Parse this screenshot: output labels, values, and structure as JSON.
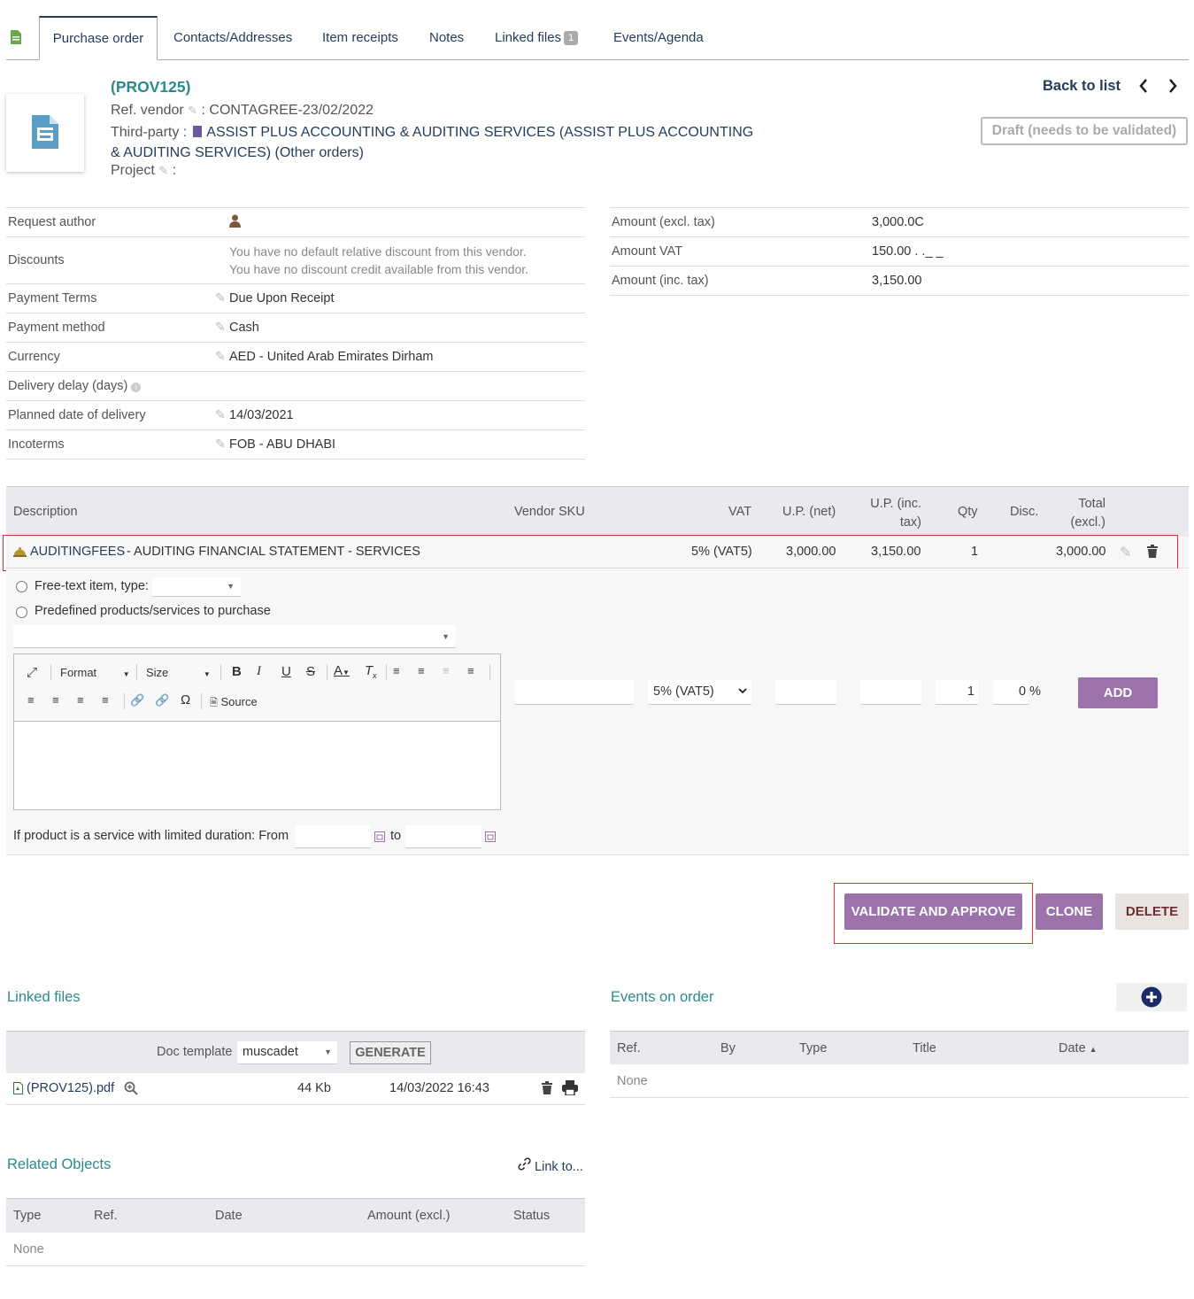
{
  "tabs": [
    {
      "label": "Purchase order"
    },
    {
      "label": "Contacts/Addresses"
    },
    {
      "label": "Item receipts"
    },
    {
      "label": "Notes"
    },
    {
      "label": "Linked files",
      "badge": "1"
    },
    {
      "label": "Events/Agenda"
    }
  ],
  "header": {
    "ref": "(PROV125)",
    "ref_vendor_label": "Ref. vendor",
    "ref_vendor_value": ": CONTAGREE-23/02/2022",
    "thirdparty_label": "Third-party :",
    "thirdparty_name_line1": "ASSIST PLUS ACCOUNTING & AUDITING SERVICES (ASSIST PLUS ACCOUNTING",
    "thirdparty_name_line2": "& AUDITING SERVICES)",
    "other_orders": "(Other orders)",
    "project_label": "Project",
    "project_suffix": ":",
    "back_to_list": "Back to list",
    "status": "Draft (needs to be validated)"
  },
  "fields": [
    {
      "label": "Request author",
      "value": ""
    },
    {
      "label": "Discounts",
      "value_line1": "You have no default relative discount from this vendor.",
      "value_line2": "You have no discount credit available from this vendor."
    },
    {
      "label": "Payment Terms",
      "value": "Due Upon Receipt"
    },
    {
      "label": "Payment method",
      "value": "Cash"
    },
    {
      "label": "Currency",
      "value": "AED - United Arab Emirates Dirham"
    },
    {
      "label": "Delivery delay (days)",
      "value": ""
    },
    {
      "label": "Planned date of delivery",
      "value": "14/03/2021"
    },
    {
      "label": "Incoterms",
      "value": "FOB - ABU DHABI"
    }
  ],
  "amounts": [
    {
      "label": "Amount (excl. tax)",
      "value": "3,000.0C"
    },
    {
      "label": "Amount VAT",
      "value": "150.00 . ._ _"
    },
    {
      "label": "Amount (inc. tax)",
      "value": "3,150.00"
    }
  ],
  "lines": {
    "headers": {
      "description": "Description",
      "vendor_sku": "Vendor SKU",
      "vat": "VAT",
      "up_net": "U.P. (net)",
      "up_inc_1": "U.P. (inc.",
      "up_inc_2": "tax)",
      "qty": "Qty",
      "disc": "Disc.",
      "total_1": "Total",
      "total_2": "(excl.)"
    },
    "rows": [
      {
        "product_ref": "AUDITINGFEES",
        "description": "- AUDITING FINANCIAL STATEMENT - SERVICES",
        "vat": "5% (VAT5)",
        "up_net": "3,000.00",
        "up_inc": "3,150.00",
        "qty": "1",
        "total": "3,000.00"
      }
    ]
  },
  "add_line": {
    "free_text_label": "Free-text item, type:",
    "predefined_label": "Predefined products/services to purchase",
    "toolbar": {
      "format": "Format",
      "size": "Size",
      "source": "Source"
    },
    "vat_selected": "5% (VAT5)",
    "qty_default": "1",
    "disc_default": "0 %",
    "add_button": "ADD",
    "service_label": "If product is a service with limited duration: From",
    "to_label": "to"
  },
  "actions": {
    "validate": "VALIDATE AND APPROVE",
    "clone": "CLONE",
    "delete": "DELETE"
  },
  "linked_files": {
    "title": "Linked files",
    "doc_template_label": "Doc template",
    "doc_template_value": "muscadet",
    "generate": "GENERATE",
    "file_name": "(PROV125).pdf",
    "file_size": "44 Kb",
    "file_date": "14/03/2022 16:43"
  },
  "events": {
    "title": "Events on order",
    "headers": [
      "Ref.",
      "By",
      "Type",
      "Title",
      "Date"
    ],
    "empty": "None"
  },
  "related": {
    "title": "Related Objects",
    "link_to": "Link to...",
    "headers": [
      "Type",
      "Ref.",
      "Date",
      "Amount (excl.)",
      "Status"
    ],
    "empty": "None"
  },
  "colors": {
    "accent": "#9b72aa",
    "link": "#263c5c",
    "section_title": "#2c8a8e",
    "highlight_box": "#e03030"
  }
}
